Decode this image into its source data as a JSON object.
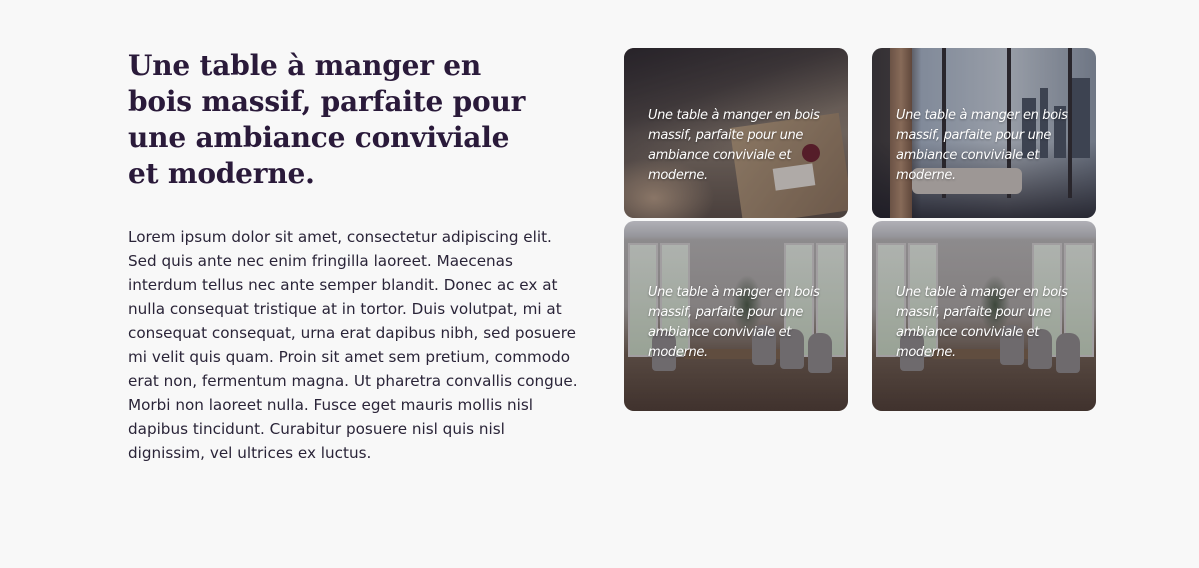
{
  "section": {
    "heading": "Une table à manger en bois massif, parfaite pour une ambiance conviviale et moderne.",
    "body": "Lorem ipsum dolor sit amet, consectetur adipiscing elit. Sed quis ante nec enim fringilla laoreet. Maecenas interdum tellus nec ante semper blandit. Donec ac ex at nulla consequat tristique at in tortor. Duis volutpat, mi at consequat consequat, urna erat dapibus nibh, sed posuere mi velit quis quam. Proin sit amet sem pretium, commodo erat non, fermentum magna. Ut pharetra convallis congue. Morbi non laoreet nulla. Fusce eget mauris mollis nisl dapibus tincidunt. Curabitur posuere nisl quis nisl dignissim, vel ultrices ex luctus."
  },
  "gallery": {
    "cards": [
      {
        "caption": "Une table à manger en bois massif, parfaite pour une ambiance conviviale et moderne."
      },
      {
        "caption": "Une table à manger en bois massif, parfaite pour une ambiance conviviale et moderne."
      },
      {
        "caption": "Une table à manger en bois massif, parfaite pour une ambiance conviviale et moderne."
      },
      {
        "caption": "Une table à manger en bois massif, parfaite pour une ambiance conviviale et moderne."
      }
    ]
  },
  "colors": {
    "background": "#f8f8f8",
    "heading": "#2a1a3a",
    "body_text": "#2a2438",
    "caption_text": "#ffffff"
  }
}
